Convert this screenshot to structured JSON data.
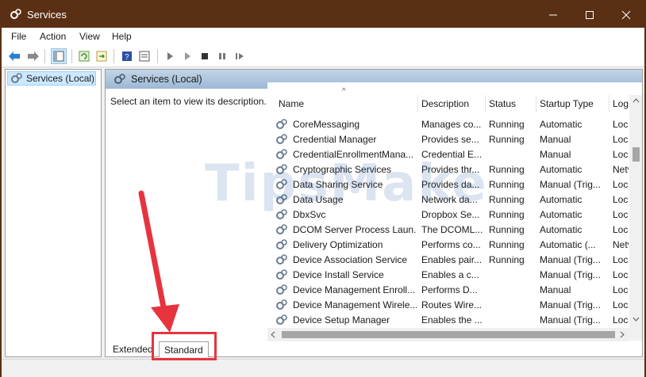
{
  "window": {
    "title": "Services",
    "controls": {
      "minimize": "—",
      "maximize": "☐",
      "close": "✕"
    }
  },
  "menu": [
    "File",
    "Action",
    "View",
    "Help"
  ],
  "tree": {
    "selected": "Services (Local)"
  },
  "pane": {
    "header": "Services (Local)",
    "description": "Select an item to view its description."
  },
  "columns": [
    "Name",
    "Description",
    "Status",
    "Startup Type",
    "Log"
  ],
  "rows": [
    {
      "name": "CoreMessaging",
      "desc": "Manages co...",
      "status": "Running",
      "startup": "Automatic",
      "log": "Loca"
    },
    {
      "name": "Credential Manager",
      "desc": "Provides se...",
      "status": "Running",
      "startup": "Manual",
      "log": "Loca"
    },
    {
      "name": "CredentialEnrollmentMana...",
      "desc": "Credential E...",
      "status": "",
      "startup": "Manual",
      "log": "Loca"
    },
    {
      "name": "Cryptographic Services",
      "desc": "Provides thr...",
      "status": "Running",
      "startup": "Automatic",
      "log": "Netv"
    },
    {
      "name": "Data Sharing Service",
      "desc": "Provides da...",
      "status": "Running",
      "startup": "Manual (Trig...",
      "log": "Loca"
    },
    {
      "name": "Data Usage",
      "desc": "Network da...",
      "status": "Running",
      "startup": "Automatic",
      "log": "Loca"
    },
    {
      "name": "DbxSvc",
      "desc": "Dropbox Se...",
      "status": "Running",
      "startup": "Automatic",
      "log": "Loca"
    },
    {
      "name": "DCOM Server Process Laun...",
      "desc": "The DCOML...",
      "status": "Running",
      "startup": "Automatic",
      "log": "Loca"
    },
    {
      "name": "Delivery Optimization",
      "desc": "Performs co...",
      "status": "Running",
      "startup": "Automatic (...",
      "log": "Netv"
    },
    {
      "name": "Device Association Service",
      "desc": "Enables pair...",
      "status": "Running",
      "startup": "Manual (Trig...",
      "log": "Loca"
    },
    {
      "name": "Device Install Service",
      "desc": "Enables a c...",
      "status": "",
      "startup": "Manual (Trig...",
      "log": "Loca"
    },
    {
      "name": "Device Management Enroll...",
      "desc": "Performs D...",
      "status": "",
      "startup": "Manual",
      "log": "Loca"
    },
    {
      "name": "Device Management Wirele...",
      "desc": "Routes Wire...",
      "status": "",
      "startup": "Manual (Trig...",
      "log": "Loca"
    },
    {
      "name": "Device Setup Manager",
      "desc": "Enables the ...",
      "status": "",
      "startup": "Manual (Trig...",
      "log": "Loca"
    }
  ],
  "tabs": {
    "extended": "Extended",
    "standard": "Standard"
  },
  "watermark": "TipsMake",
  "colors": {
    "titlebar": "#5a2f14",
    "annotation": "#e6343f",
    "selection": "#cce8ff"
  },
  "icons": {
    "app": "gear-icon",
    "back": "back-arrow-icon",
    "forward": "forward-arrow-icon",
    "console": "console-tree-icon",
    "refresh": "refresh-icon",
    "export": "export-list-icon",
    "help": "help-icon",
    "properties": "properties-icon",
    "start": "play-icon",
    "start-alt": "play-outline-icon",
    "stop": "stop-icon",
    "pause": "pause-icon",
    "restart": "restart-icon"
  }
}
